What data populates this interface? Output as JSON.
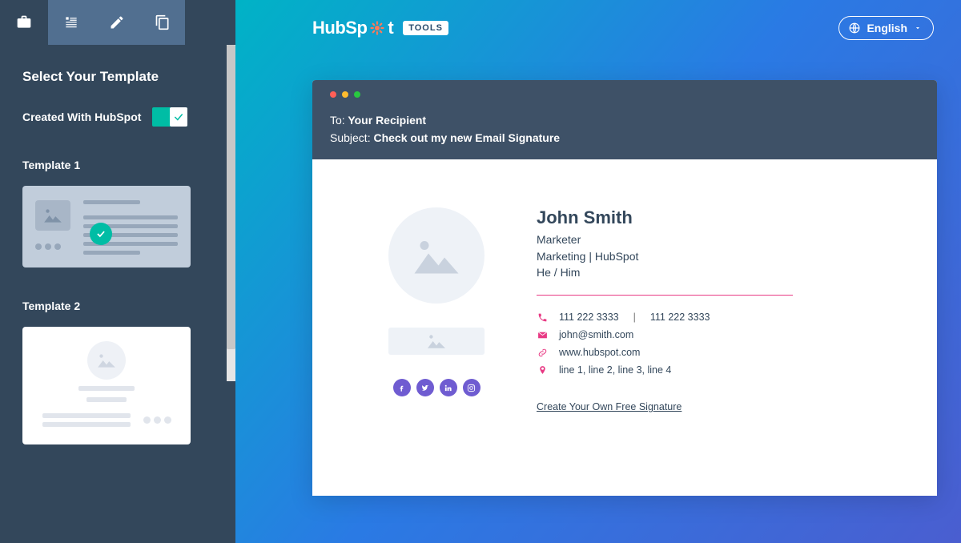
{
  "sidebar": {
    "title": "Select Your Template",
    "toggle_label": "Created With HubSpot",
    "template1_label": "Template 1",
    "template2_label": "Template 2"
  },
  "header": {
    "logo_prefix": "HubSp",
    "logo_suffix": "t",
    "tools_badge": "TOOLS",
    "language": "English"
  },
  "mail": {
    "to_label": "To:",
    "to_value": "Your Recipient",
    "subject_label": "Subject:",
    "subject_value": "Check out my new Email Signature"
  },
  "signature": {
    "name": "John Smith",
    "job_title": "Marketer",
    "dept_company": "Marketing | HubSpot",
    "pronouns": "He / Him",
    "phone1": "111 222 3333",
    "phone2": "111 222 3333",
    "email": "john@smith.com",
    "website": "www.hubspot.com",
    "address": "line 1, line 2, line 3, line 4",
    "cta": "Create Your Own Free Signature"
  }
}
